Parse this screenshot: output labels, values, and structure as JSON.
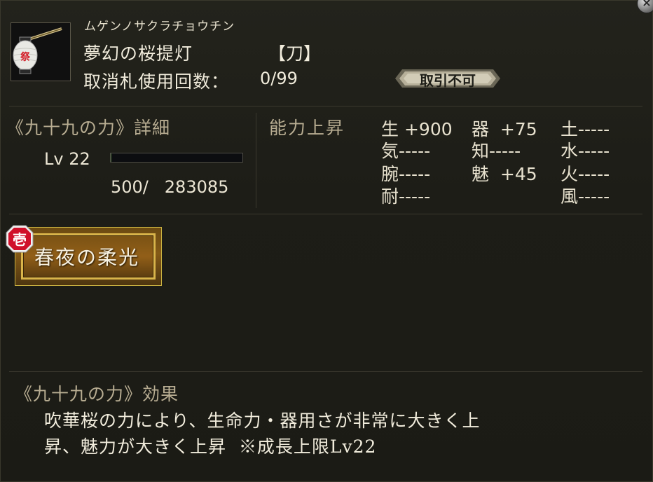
{
  "window": {
    "close_label": "×"
  },
  "item": {
    "icon": "paper-lantern-icon",
    "reading": "ムゲンノサクラチョウチン",
    "name": "夢幻の桜提灯",
    "type": "【刀】",
    "usage_label": "取消札使用回数：",
    "usage_value": "0/99",
    "trade_badge": "取引不可"
  },
  "detail": {
    "title": "《九十九の力》詳細",
    "level_label": "Lv 22",
    "level_progress": 0.0018,
    "exp_text": "500/   283085"
  },
  "ability": {
    "title": "能力上昇",
    "stats": [
      {
        "key": "生",
        "value": " +900"
      },
      {
        "key": "気",
        "value": "-----"
      },
      {
        "key": "腕",
        "value": "-----"
      },
      {
        "key": "耐",
        "value": "-----"
      },
      {
        "key": "器",
        "value": "  +75"
      },
      {
        "key": "知",
        "value": "-----"
      },
      {
        "key": "魅",
        "value": "  +45"
      },
      {
        "key": "土",
        "value": "-----"
      },
      {
        "key": "水",
        "value": "-----"
      },
      {
        "key": "火",
        "value": "-----"
      },
      {
        "key": "風",
        "value": "-----"
      }
    ]
  },
  "skill": {
    "badge": "壱",
    "label": "春夜の柔光"
  },
  "effect": {
    "title": "《九十九の力》効果",
    "line1": "吹華桜の力により、生命力・器用さが非常に大きく上",
    "line2": "昇、魅力が大きく上昇  ※成長上限Lv22"
  },
  "colors": {
    "background": "#1c1c16",
    "heading": "#b8ad92",
    "text": "#ece6d4",
    "skill_gold": "#d9b44a",
    "badge_red": "#d0102a"
  }
}
